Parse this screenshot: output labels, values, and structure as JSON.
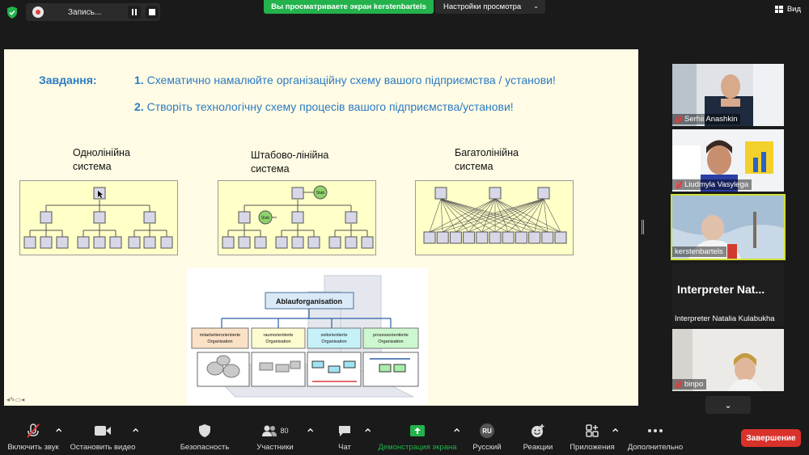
{
  "topbar": {
    "recording_label": "Запись...",
    "share_banner": "Вы просматриваете экран kerstenbartels",
    "view_options": "Настройки просмотра",
    "view_label": "Вид"
  },
  "slide": {
    "task_label": "Завдання:",
    "tasks": [
      {
        "num": "1.",
        "text": "Схематично намалюйте організаційну схему вашого підприємства / установи!"
      },
      {
        "num": "2.",
        "text": "Створіть технологічну схему процесів вашого підприємства/установи!"
      }
    ],
    "diagrams": [
      {
        "title_line1": "Однолінійна",
        "title_line2": "система"
      },
      {
        "title_line1": "Штабово-лінійна",
        "title_line2": "система",
        "stab_label": "Stab"
      },
      {
        "title_line1": "Багатолінійна",
        "title_line2": "система"
      }
    ],
    "process_image": {
      "title": "Ablauforganisation",
      "boxes": [
        {
          "line1": "mitarbeiterorientierte",
          "line2": "Organisation",
          "color": "#fbe1c6"
        },
        {
          "line1": "raumorientierte",
          "line2": "Organisation",
          "color": "#fdfbd0"
        },
        {
          "line1": "zeitorientierte",
          "line2": "Organisation",
          "color": "#c6f1f8"
        },
        {
          "line1": "prozessorientierte",
          "line2": "Organisation",
          "color": "#cdf7cf"
        }
      ]
    }
  },
  "participants": [
    {
      "name": "Serhii Anashkin",
      "muted": true
    },
    {
      "name": "Liudmyla Vasylega",
      "muted": true
    },
    {
      "name": "kerstenbartels",
      "muted": false,
      "active": true
    },
    {
      "name": "Interpreter Natalia Kulabukha",
      "display_text": "Interpreter  Nat...",
      "muted": false
    },
    {
      "name": "binpo",
      "muted": true
    }
  ],
  "toolbar": {
    "mute": "Включить звук",
    "video": "Остановить видео",
    "security": "Безопасность",
    "participants": "Участники",
    "participants_count": "80",
    "chat": "Чат",
    "share": "Демонстрация экрана",
    "language_badge": "RU",
    "language": "Русский",
    "reactions": "Реакции",
    "apps": "Приложения",
    "more": "Дополнительно",
    "end": "Завершение"
  },
  "colors": {
    "accent_green": "#23b24c",
    "end_red": "#d9322b",
    "slide_text_blue": "#2b7bc4",
    "active_speaker": "#cfe035"
  }
}
